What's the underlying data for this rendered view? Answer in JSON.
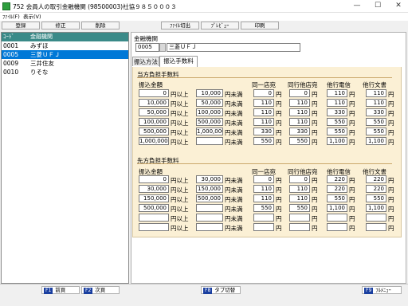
{
  "window": {
    "title": "752 会員人の取引金融機関 (98500003)社協９８５０００３",
    "minimize": "—",
    "maximize": "☐",
    "close": "✕"
  },
  "menu": [
    "ﾌｧｲﾙ(F)",
    "表示(V)"
  ],
  "toolbar": [
    "登録",
    "修正",
    "削除",
    "ﾌｧｲﾙ切出",
    "ﾌﾟﾚﾋﾞｭｰ",
    "印刷"
  ],
  "list": {
    "headers": [
      "ｺｰﾄﾞ",
      "金融機関"
    ],
    "rows": [
      {
        "code": "0001",
        "name": "みずほ"
      },
      {
        "code": "0005",
        "name": "三菱ＵＦＪ"
      },
      {
        "code": "0009",
        "name": "三井住友"
      },
      {
        "code": "0010",
        "name": "りそな"
      }
    ],
    "selected_index": 1
  },
  "detail": {
    "label": "金融機関",
    "code": "0005",
    "name": "三菱ＵＦＪ",
    "tabs": [
      "振込方法",
      "振込手数料"
    ],
    "active_tab": 1
  },
  "fees": {
    "col_headers": [
      "振込金額",
      "同一店宛",
      "同行他店宛",
      "他行電信",
      "他行文書"
    ],
    "unit_from": "円以上",
    "unit_to": "円未満",
    "yen": "円",
    "self": {
      "title": "当方負担手数料",
      "rows": [
        {
          "from": "0",
          "to": "10,000",
          "same": "0",
          "other": "0",
          "tel": "110",
          "doc": "110"
        },
        {
          "from": "10,000",
          "to": "50,000",
          "same": "110",
          "other": "110",
          "tel": "110",
          "doc": "110"
        },
        {
          "from": "50,000",
          "to": "100,000",
          "same": "110",
          "other": "110",
          "tel": "330",
          "doc": "330"
        },
        {
          "from": "100,000",
          "to": "500,000",
          "same": "110",
          "other": "110",
          "tel": "550",
          "doc": "550"
        },
        {
          "from": "500,000",
          "to": "1,000,000",
          "same": "330",
          "other": "330",
          "tel": "550",
          "doc": "550"
        },
        {
          "from": "1,000,000",
          "to": "",
          "same": "550",
          "other": "550",
          "tel": "1,100",
          "doc": "1,100"
        }
      ]
    },
    "payee": {
      "title": "先方負担手数料",
      "rows": [
        {
          "from": "0",
          "to": "30,000",
          "same": "0",
          "other": "0",
          "tel": "220",
          "doc": "220"
        },
        {
          "from": "30,000",
          "to": "150,000",
          "same": "110",
          "other": "110",
          "tel": "220",
          "doc": "220"
        },
        {
          "from": "150,000",
          "to": "500,000",
          "same": "110",
          "other": "110",
          "tel": "550",
          "doc": "550"
        },
        {
          "from": "500,000",
          "to": "",
          "same": "550",
          "other": "550",
          "tel": "1,100",
          "doc": "1,100"
        },
        {
          "from": "",
          "to": "",
          "same": "",
          "other": "",
          "tel": "",
          "doc": ""
        },
        {
          "from": "",
          "to": "",
          "same": "",
          "other": "",
          "tel": "",
          "doc": ""
        }
      ]
    }
  },
  "status": [
    {
      "key": "F1",
      "label": "前頁"
    },
    {
      "key": "F2",
      "label": "次頁"
    },
    {
      "key": "F8",
      "label": "タブ切替"
    },
    {
      "key": "F9",
      "label": "ﾌﾙﾒﾆｭｰ"
    }
  ],
  "colors": {
    "accent": "#0078d7",
    "list_header": "#3a8a88",
    "panel_bg": "#fbf0d5",
    "fkey": "#1a3fa0"
  }
}
